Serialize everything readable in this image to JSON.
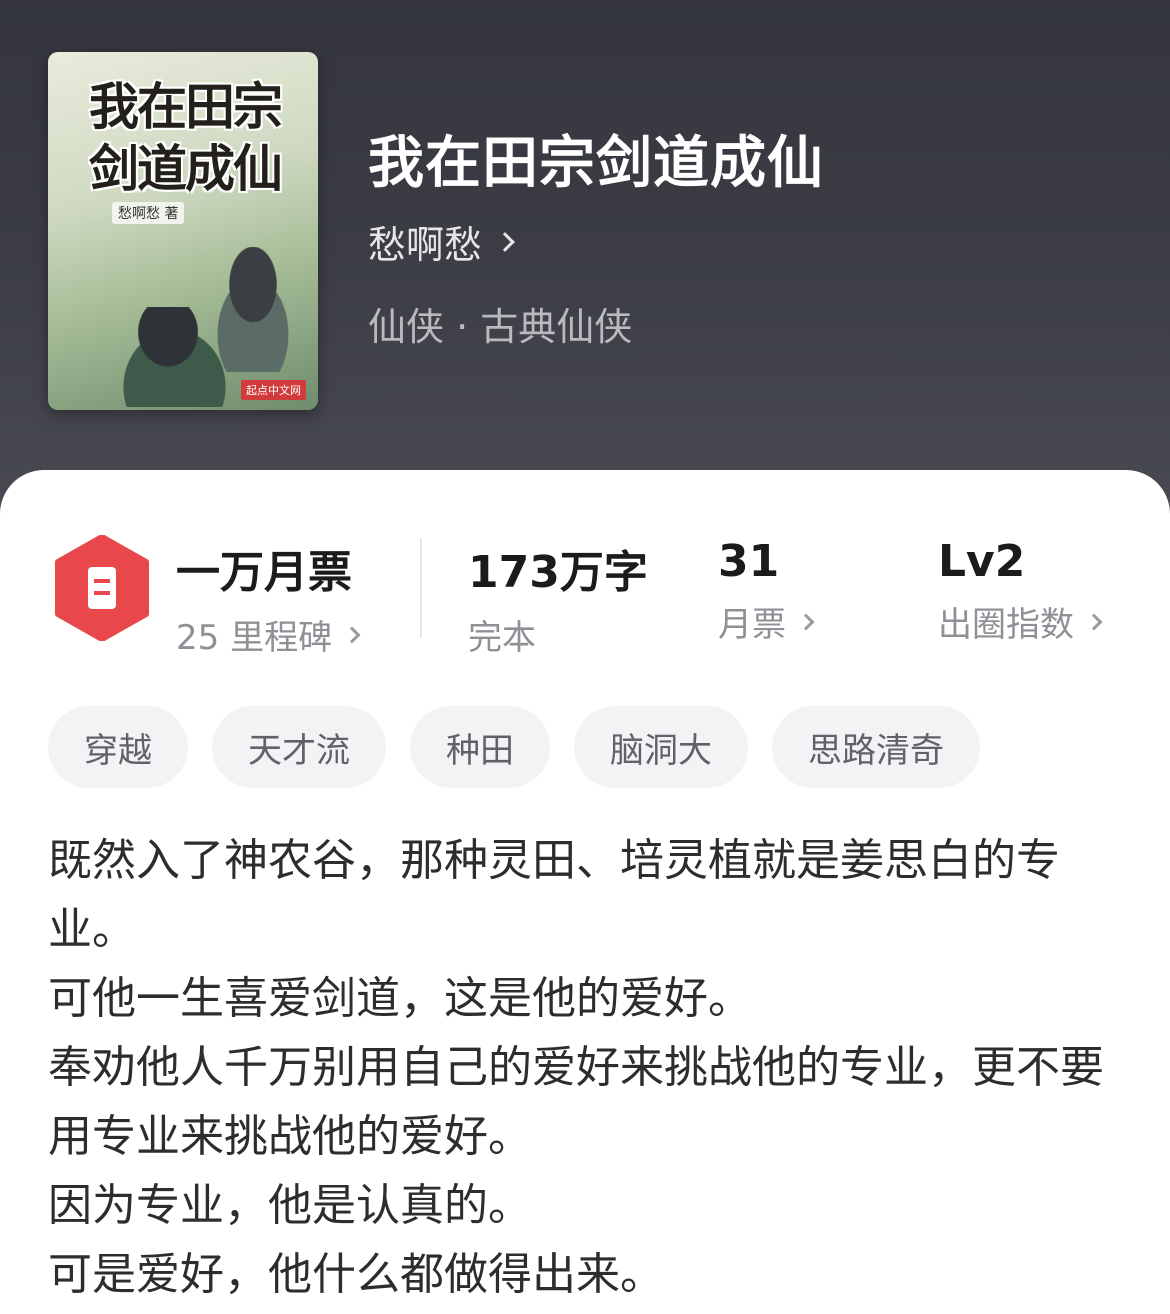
{
  "book": {
    "title": "我在田宗剑道成仙",
    "author": "愁啊愁",
    "genre": "仙侠 · 古典仙侠"
  },
  "cover": {
    "title_line1": "我在田宗",
    "title_line2": "剑道成仙",
    "author_credit": "愁啊愁 著",
    "publisher": "起点中文网"
  },
  "stats": {
    "ticket": {
      "value": "一万月票",
      "label": "25 里程碑"
    },
    "words": {
      "value": "173万字",
      "label": "完本"
    },
    "monthly": {
      "value": "31",
      "label": "月票"
    },
    "level": {
      "value": "Lv2",
      "label": "出圈指数"
    }
  },
  "tags": [
    "穿越",
    "天才流",
    "种田",
    "脑洞大",
    "思路清奇"
  ],
  "description": [
    "既然入了神农谷，那种灵田、培灵植就是姜思白的专业。",
    "可他一生喜爱剑道，这是他的爱好。",
    "奉劝他人千万别用自己的爱好来挑战他的专业，更不要用专业来挑战他的爱好。",
    "因为专业，他是认真的。",
    "可是爱好，他什么都做得出来。"
  ],
  "colors": {
    "header_bg": "#3b3c44",
    "badge_red": "#e8484c",
    "text_primary": "#1b1b1d",
    "text_secondary": "#8f9096",
    "tag_bg": "#f3f3f5"
  },
  "icons": [
    "ticket-badge-icon",
    "chevron-right-icon"
  ]
}
